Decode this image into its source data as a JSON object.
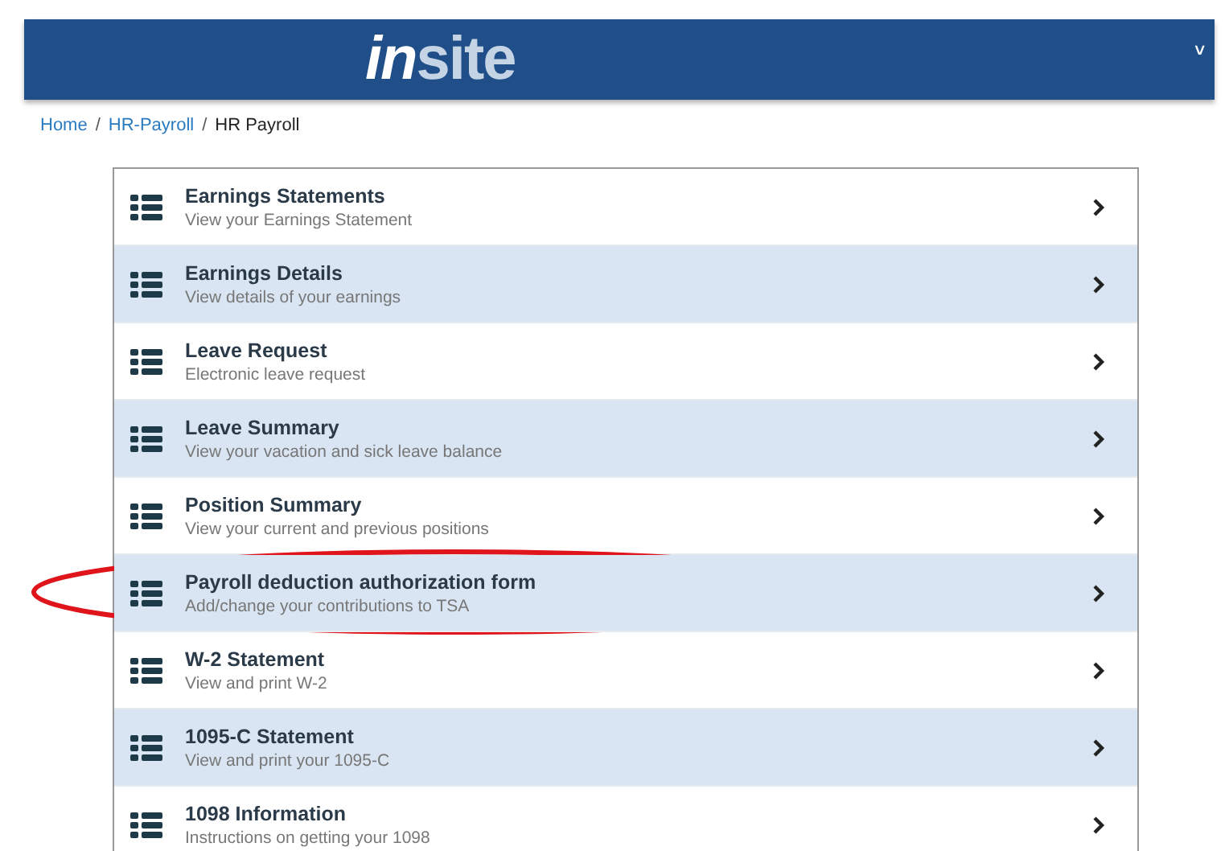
{
  "header": {
    "logo": [
      "in",
      "site"
    ],
    "menu_caret": "˅"
  },
  "breadcrumb_separator": "/",
  "breadcrumb": [
    {
      "label": "Home",
      "link": true
    },
    {
      "label": "HR-Payroll",
      "link": true
    },
    {
      "label": "HR Payroll",
      "link": false
    }
  ],
  "items": [
    {
      "title": "Earnings Statements",
      "subtitle": "View your Earnings Statement",
      "circled": false
    },
    {
      "title": "Earnings Details",
      "subtitle": "View details of your earnings",
      "circled": false
    },
    {
      "title": "Leave Request",
      "subtitle": "Electronic leave request",
      "circled": false
    },
    {
      "title": "Leave Summary",
      "subtitle": "View your vacation and sick leave balance",
      "circled": false
    },
    {
      "title": "Position Summary",
      "subtitle": "View your current and previous positions",
      "circled": false
    },
    {
      "title": "Payroll deduction authorization form",
      "subtitle": "Add/change your contributions to TSA",
      "circled": true
    },
    {
      "title": "W-2 Statement",
      "subtitle": "View and print W-2",
      "circled": false
    },
    {
      "title": "1095-C Statement",
      "subtitle": "View and print your 1095-C",
      "circled": false
    },
    {
      "title": "1098 Information",
      "subtitle": "Instructions on getting your 1098",
      "circled": false
    }
  ]
}
